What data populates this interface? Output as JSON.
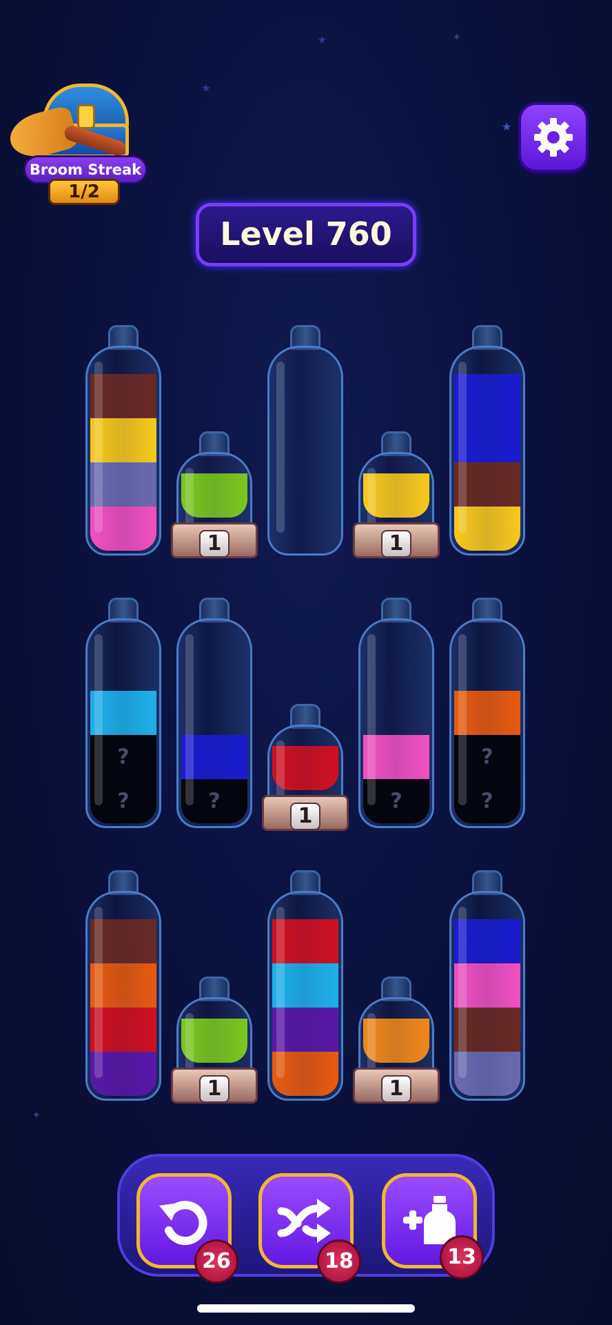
{
  "streak": {
    "title": "Broom Streak",
    "count": "1/2"
  },
  "level": {
    "label": "Level 760"
  },
  "colors": {
    "brown": "#6a2a24",
    "yellow": "#f8c81c",
    "slate": "#6a6ab0",
    "pink": "#f050c0",
    "green": "#7ac81e",
    "blue": "#1a1cd0",
    "cyan": "#1eb0e8",
    "red": "#d01020",
    "orange": "#e85a10",
    "purple": "#5a18a8",
    "light_orange": "#f08818"
  },
  "tubes": [
    {
      "id": "r1c1",
      "size": "tall",
      "layers": [
        "brown",
        "yellow",
        "slate",
        "pink"
      ]
    },
    {
      "id": "r1c2",
      "size": "small",
      "layers": [
        "green"
      ],
      "pedestal": "1"
    },
    {
      "id": "r1c3",
      "size": "tall",
      "layers": []
    },
    {
      "id": "r1c4",
      "size": "small",
      "layers": [
        "yellow"
      ],
      "pedestal": "1"
    },
    {
      "id": "r1c5",
      "size": "tall",
      "layers": [
        "blue",
        "blue",
        "brown",
        "yellow"
      ]
    },
    {
      "id": "r2c1",
      "size": "tall",
      "layers": [
        "cyan",
        "hidden",
        "hidden"
      ]
    },
    {
      "id": "r2c2",
      "size": "tall",
      "layers": [
        "blue",
        "hidden"
      ]
    },
    {
      "id": "r2c3",
      "size": "small",
      "layers": [
        "red"
      ],
      "pedestal": "1"
    },
    {
      "id": "r2c4",
      "size": "tall",
      "layers": [
        "pink",
        "hidden"
      ]
    },
    {
      "id": "r2c5",
      "size": "tall",
      "layers": [
        "orange",
        "hidden",
        "hidden"
      ]
    },
    {
      "id": "r3c1",
      "size": "tall",
      "layers": [
        "brown",
        "orange",
        "red",
        "purple"
      ]
    },
    {
      "id": "r3c2",
      "size": "small",
      "layers": [
        "green"
      ],
      "pedestal": "1"
    },
    {
      "id": "r3c3",
      "size": "tall",
      "layers": [
        "red",
        "cyan",
        "purple",
        "orange"
      ]
    },
    {
      "id": "r3c4",
      "size": "small",
      "layers": [
        "light_orange"
      ],
      "pedestal": "1"
    },
    {
      "id": "r3c5",
      "size": "tall",
      "layers": [
        "blue",
        "pink",
        "brown",
        "slate"
      ]
    }
  ],
  "hidden_mark": "?",
  "toolbar": {
    "undo": {
      "icon": "undo-icon",
      "count": "26"
    },
    "shuffle": {
      "icon": "shuffle-icon",
      "count": "18"
    },
    "add_bottle": {
      "icon": "add-bottle-icon",
      "count": "13"
    }
  }
}
